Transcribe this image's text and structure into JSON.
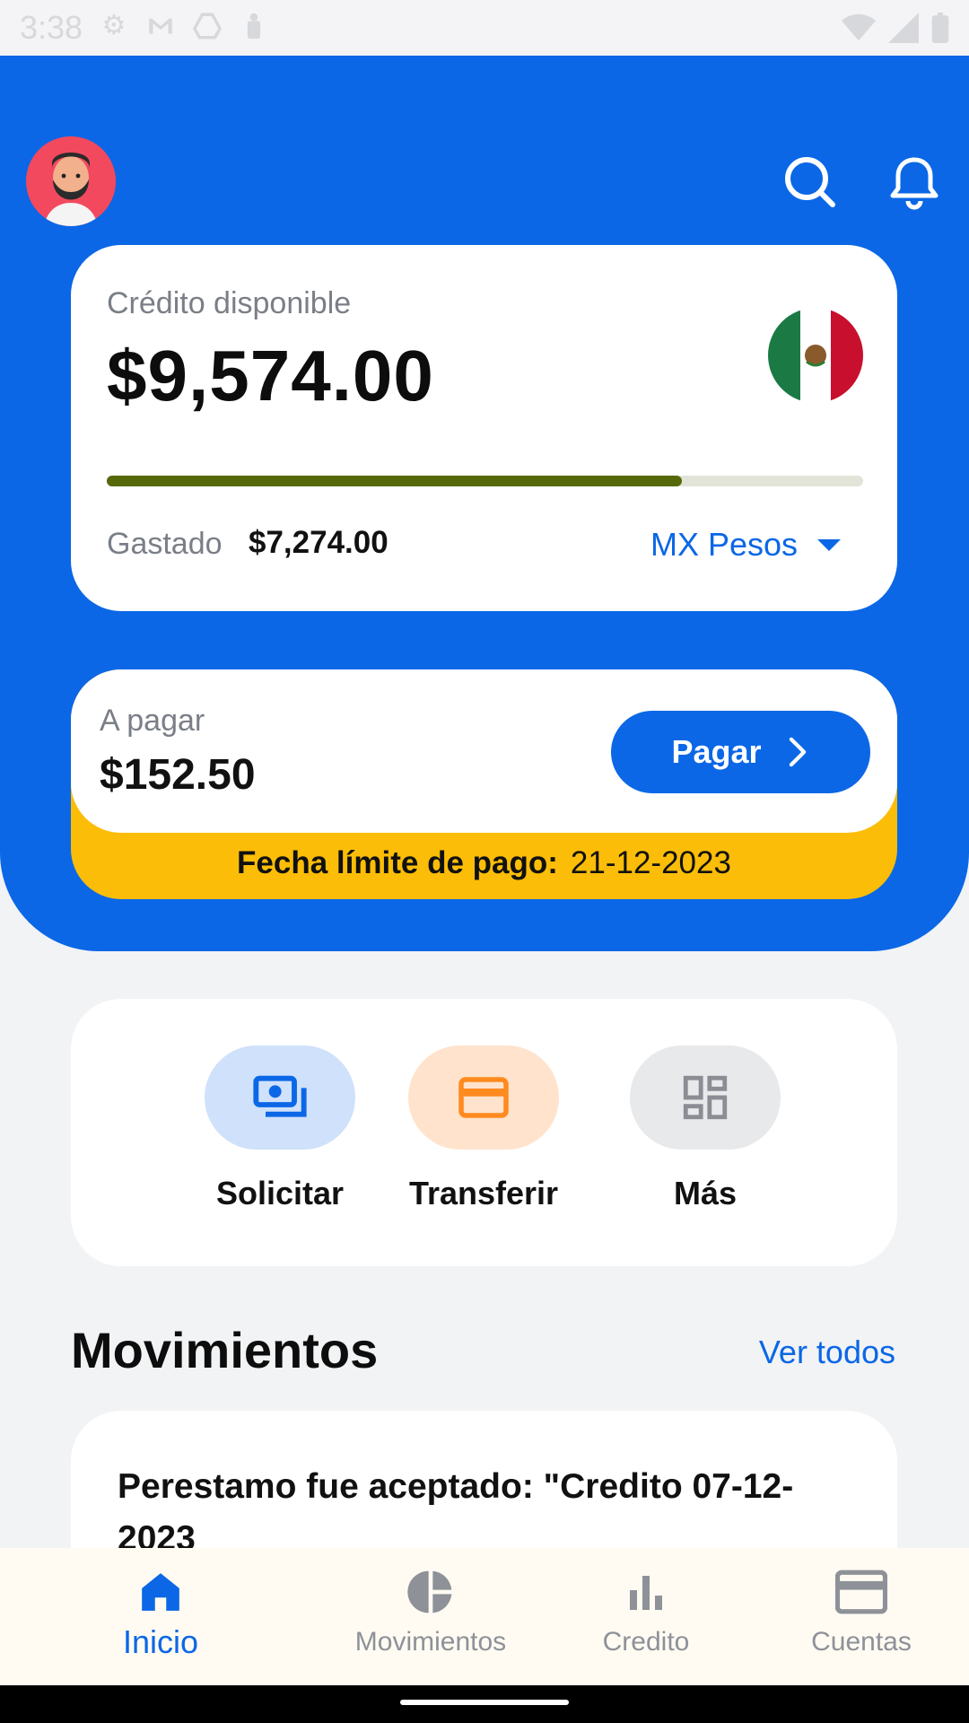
{
  "status_bar": {
    "time": "3:38",
    "icons": [
      "gear-icon",
      "mail-icon",
      "drive-icon",
      "lock-icon"
    ],
    "right_icons": [
      "wifi-icon",
      "signal-icon",
      "battery-icon"
    ]
  },
  "header": {
    "avatar": "avatar-bearded-man",
    "icons": [
      "search-icon",
      "bell-icon"
    ]
  },
  "credit": {
    "label": "Crédito disponible",
    "amount": "$9,574.00",
    "flag": "mexico-flag",
    "progress_fraction": 0.76,
    "spent_label": "Gastado",
    "spent_value": "$7,274.00",
    "currency": "MX Pesos"
  },
  "payment": {
    "label": "A pagar",
    "amount": "$152.50",
    "button": "Pagar",
    "deadline_label": "Fecha límite de pago:",
    "deadline_date": "21-12-2023"
  },
  "actions": [
    {
      "label": "Solicitar",
      "icon": "money-icon",
      "bg": "#CFE1FB",
      "fg": "#0B67E6"
    },
    {
      "label": "Transferir",
      "icon": "card-icon",
      "bg": "#FFE3CC",
      "fg": "#FF8A1E"
    },
    {
      "label": "Más",
      "icon": "grid-icon",
      "bg": "#E8E9EB",
      "fg": "#8A8D93"
    }
  ],
  "movements": {
    "title": "Movimientos",
    "link": "Ver todos",
    "items": [
      {
        "text": "Perestamo fue aceptado: \"Credito 07-12-2023"
      }
    ]
  },
  "bottom_nav": [
    {
      "label": "Inicio",
      "icon": "home-icon",
      "active": true
    },
    {
      "label": "Movimientos",
      "icon": "pie-chart-icon",
      "active": false
    },
    {
      "label": "Credito",
      "icon": "bar-chart-icon",
      "active": false
    },
    {
      "label": "Cuentas",
      "icon": "card-icon",
      "active": false
    }
  ],
  "colors": {
    "primary": "#0B67E6",
    "warning": "#FBBD07",
    "progress": "#55680A"
  }
}
